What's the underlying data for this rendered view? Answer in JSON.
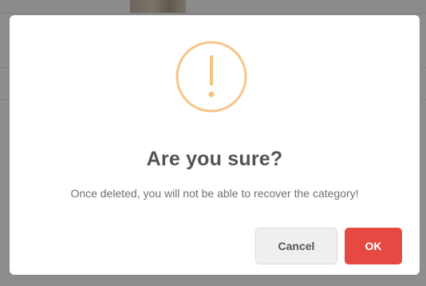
{
  "dialog": {
    "icon": "warning-icon",
    "title": "Are you sure?",
    "message": "Once deleted, you will not be able to recover the category!",
    "cancel_label": "Cancel",
    "ok_label": "OK"
  },
  "colors": {
    "warning": "#f8c486",
    "ok_button": "#e64942",
    "cancel_button": "#efefef",
    "title_text": "#545454",
    "message_text": "#707070"
  }
}
